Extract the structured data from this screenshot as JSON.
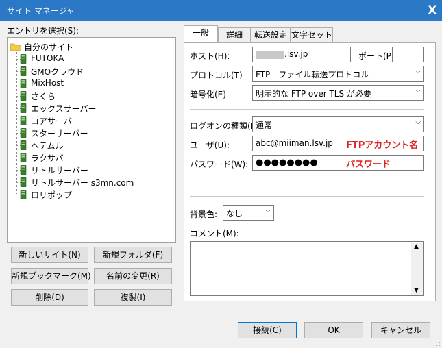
{
  "window": {
    "title": "サイト マネージャ",
    "close": "X"
  },
  "entry_label": "エントリを選択(S):",
  "tree": {
    "root": "自分のサイト",
    "items": [
      "FUTOKA",
      "GMOクラウド",
      "MixHost",
      "さくら",
      "エックスサーバー",
      "コアサーバー",
      "スターサーバー",
      "ヘテムル",
      "ラクサバ",
      "リトルサーバー",
      "リトルサーバー s3mn.com",
      "ロリポップ"
    ]
  },
  "left_buttons": {
    "new_site": "新しいサイト(N)",
    "new_folder": "新規フォルダ(F)",
    "new_bookmark": "新規ブックマーク(M)",
    "rename": "名前の変更(R)",
    "delete": "削除(D)",
    "copy": "複製(I)"
  },
  "tabs": [
    "一般",
    "詳細",
    "転送設定",
    "文字セット"
  ],
  "form": {
    "host_label": "ホスト(H):",
    "host_value": ".lsv.jp",
    "port_label": "ポート(P):",
    "port_value": "",
    "protocol_label": "プロトコル(T)",
    "protocol_value": "FTP - ファイル転送プロトコル",
    "encryption_label": "暗号化(E)",
    "encryption_value": "明示的な FTP over TLS が必要",
    "logon_label": "ログオンの種類(L):",
    "logon_value": "通常",
    "user_label": "ユーザ(U):",
    "user_value": "abc@miiman.lsv.jp",
    "user_annotation": "FTPアカウント名",
    "password_label": "パスワード(W):",
    "password_value": "●●●●●●●●",
    "password_annotation": "パスワード",
    "bgcolor_label": "背景色:",
    "bgcolor_value": "なし",
    "comment_label": "コメント(M):"
  },
  "footer": {
    "connect": "接続(C)",
    "ok": "OK",
    "cancel": "キャンセル"
  },
  "colors": {
    "titlebar": "#2b78c6",
    "annotation": "#e02020",
    "folder": "#f2c94c",
    "server": "#3a7d2c"
  }
}
